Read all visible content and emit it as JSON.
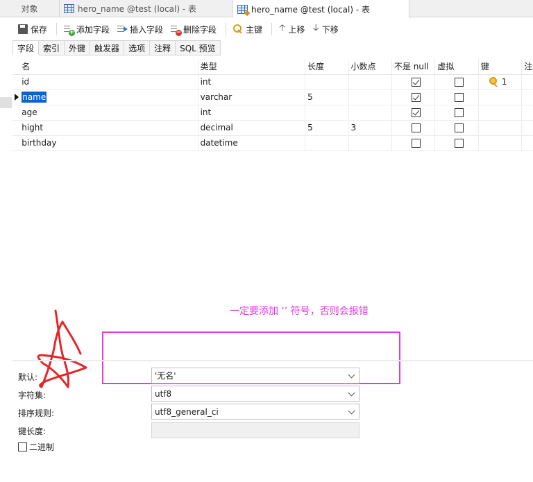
{
  "doc_tabs": [
    {
      "label": "对象"
    },
    {
      "label": "hero_name @test (local) - 表"
    },
    {
      "label": "hero_name @test (local) - 表"
    }
  ],
  "toolbar": {
    "save": "保存",
    "add_field": "添加字段",
    "insert_field": "插入字段",
    "delete_field": "删除字段",
    "primary_key": "主键",
    "move_up": "上移",
    "move_down": "下移"
  },
  "sub_tabs": [
    "字段",
    "索引",
    "外键",
    "触发器",
    "选项",
    "注释",
    "SQL 预览"
  ],
  "columns": [
    "名",
    "类型",
    "长度",
    "小数点",
    "不是 null",
    "虚拟",
    "键",
    "注释"
  ],
  "rows": [
    {
      "name": "id",
      "type": "int",
      "length": "",
      "decimal": "",
      "not_null": true,
      "virtual": false,
      "key": "1"
    },
    {
      "name": "name",
      "type": "varchar",
      "length": "5",
      "decimal": "",
      "not_null": true,
      "virtual": false,
      "key": ""
    },
    {
      "name": "age",
      "type": "int",
      "length": "",
      "decimal": "",
      "not_null": true,
      "virtual": false,
      "key": ""
    },
    {
      "name": "hight",
      "type": "decimal",
      "length": "5",
      "decimal": "3",
      "not_null": false,
      "virtual": false,
      "key": ""
    },
    {
      "name": "birthday",
      "type": "datetime",
      "length": "",
      "decimal": "",
      "not_null": false,
      "virtual": false,
      "key": ""
    }
  ],
  "annotation": {
    "text": "一定要添加  ‘’  符号，否则会报错",
    "color": "#e338e0"
  },
  "properties": {
    "default_label": "默认:",
    "default_value": "'无名'",
    "charset_label": "字符集:",
    "charset_value": "utf8",
    "collation_label": "排序规则:",
    "collation_value": "utf8_general_ci",
    "key_length_label": "键长度:",
    "binary_label": "二进制"
  }
}
